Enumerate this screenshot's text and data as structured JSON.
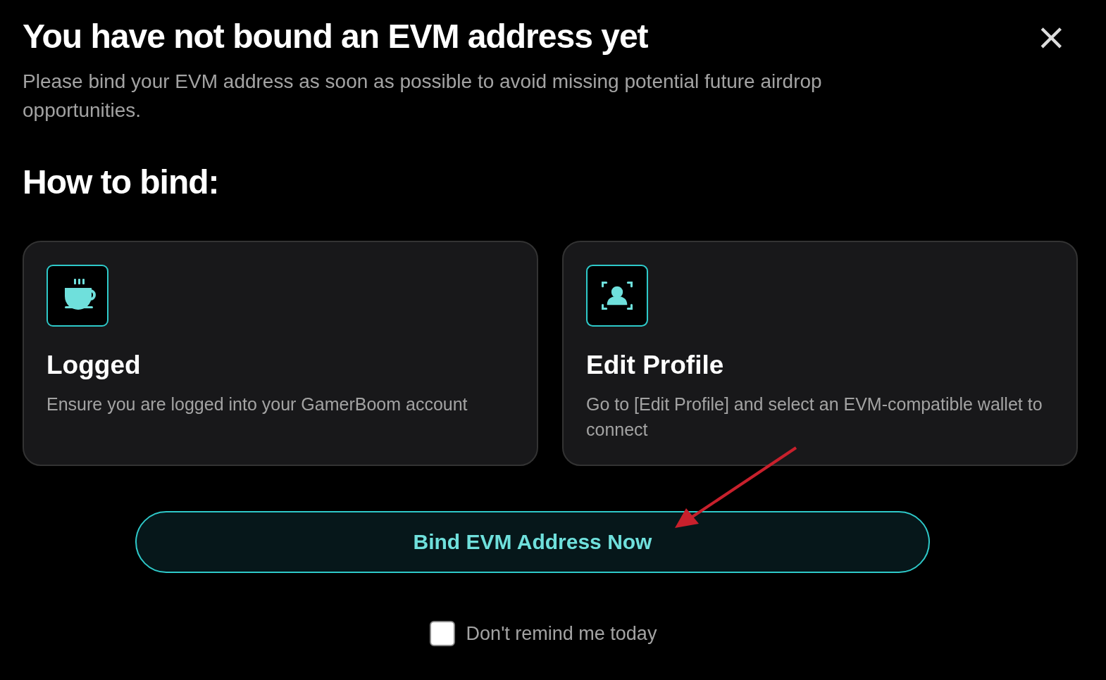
{
  "dialog": {
    "title": "You have not bound an EVM address yet",
    "close": "×",
    "message": "Please bind your EVM address as soon as possible to avoid missing potential future airdrop opportunities."
  },
  "section_title": "How to bind:",
  "steps": [
    {
      "kind": "cup",
      "title": "Logged",
      "text": "Ensure you are logged into your GamerBoom account"
    },
    {
      "kind": "profile",
      "title": "Edit Profile",
      "text": "Go to [Edit Profile] and select an EVM-compatible wallet to connect"
    }
  ],
  "primary_button": "Bind EVM Address Now",
  "remind": {
    "label": "Don't remind me today",
    "checked": false
  }
}
